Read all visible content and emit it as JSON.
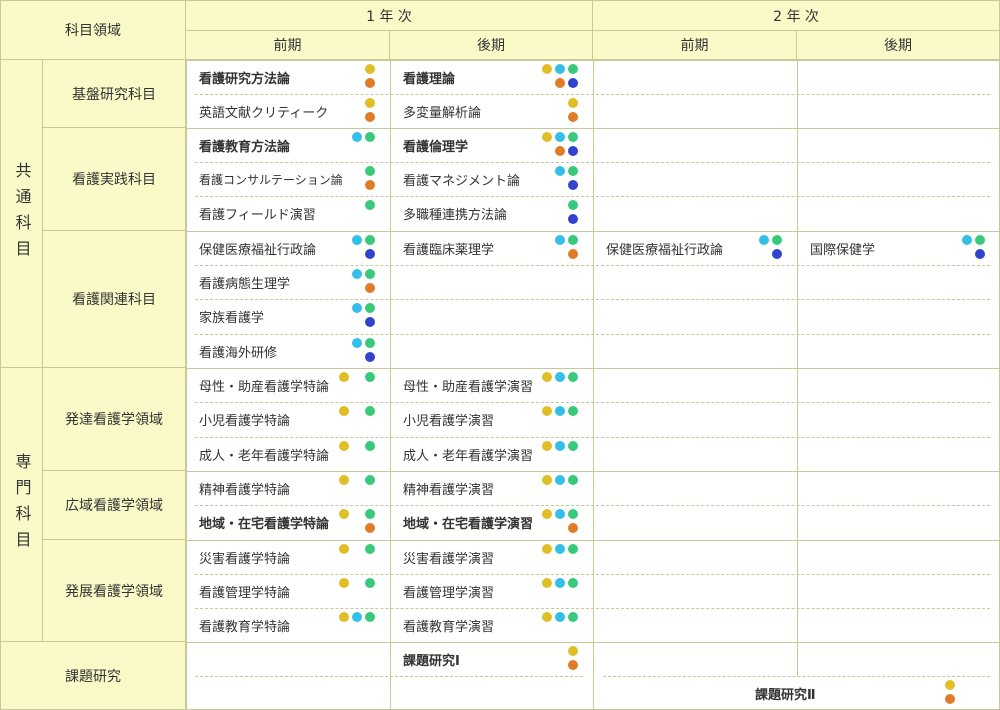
{
  "header": {
    "field_label": "科目領域",
    "year1": "1 年 次",
    "year2": "2 年 次",
    "t1_first": "前期",
    "t1_second": "後期",
    "t2_first": "前期",
    "t2_second": "後期"
  },
  "groups": {
    "common": "共通科目",
    "specialized": "専門科目"
  },
  "subgroups": {
    "kiban": "基盤研究科目",
    "jissen": "看護実践科目",
    "kanren": "看護関連科目",
    "hattatsu": "発達看護学領域",
    "kouiki": "広域看護学領域",
    "hatten": "発展看護学領域",
    "kadai": "課題研究"
  },
  "dot_colors": {
    "yellow": "#e0bf26",
    "orange": "#e07b28",
    "cyan": "#33bfe8",
    "green": "#38c97a",
    "blue": "#3344cc"
  },
  "courses": {
    "y1f": [
      {
        "label": "看護研究方法論",
        "bold": true,
        "dots": [
          [
            "yellow"
          ],
          [
            "orange"
          ]
        ]
      },
      {
        "label": "英語文献クリティーク",
        "dots": [
          [
            "yellow"
          ],
          [
            "orange"
          ]
        ]
      },
      {
        "label": "看護教育方法論",
        "bold": true,
        "dots": [
          [
            "cyan",
            "green"
          ]
        ]
      },
      {
        "label": "看護コンサルテーション論",
        "small": true,
        "dots": [
          [
            "green"
          ],
          [
            "orange"
          ]
        ]
      },
      {
        "label": "看護フィールド演習",
        "dots": [
          [
            "green"
          ]
        ]
      },
      {
        "label": "保健医療福祉行政論",
        "dots": [
          [
            "cyan",
            "green"
          ],
          [
            "blue"
          ]
        ]
      },
      {
        "label": "看護病態生理学",
        "dots": [
          [
            "cyan",
            "green"
          ],
          [
            "orange"
          ]
        ]
      },
      {
        "label": "家族看護学",
        "dots": [
          [
            "cyan",
            "green"
          ],
          [
            "blue"
          ]
        ]
      },
      {
        "label": "看護海外研修",
        "dots": [
          [
            "cyan",
            "green"
          ],
          [
            "blue"
          ]
        ]
      },
      {
        "label": "母性・助産看護学特論",
        "dots": [
          [
            "yellow",
            "",
            "green"
          ]
        ]
      },
      {
        "label": "小児看護学特論",
        "dots": [
          [
            "yellow",
            "",
            "green"
          ]
        ]
      },
      {
        "label": "成人・老年看護学特論",
        "dots": [
          [
            "yellow",
            "",
            "green"
          ]
        ]
      },
      {
        "label": "精神看護学特論",
        "dots": [
          [
            "yellow",
            "",
            "green"
          ]
        ]
      },
      {
        "label": "地域・在宅看護学特論",
        "bold": true,
        "dots": [
          [
            "yellow",
            "",
            "green"
          ],
          [
            "orange"
          ]
        ]
      },
      {
        "label": "災害看護学特論",
        "dots": [
          [
            "yellow",
            "",
            "green"
          ]
        ]
      },
      {
        "label": "看護管理学特論",
        "dots": [
          [
            "yellow",
            "",
            "green"
          ]
        ]
      },
      {
        "label": "看護教育学特論",
        "dots": [
          [
            "yellow",
            "cyan",
            "green"
          ]
        ]
      }
    ],
    "y1s": [
      {
        "label": "看護理論",
        "bold": true,
        "dots": [
          [
            "yellow",
            "cyan",
            "green"
          ],
          [
            "orange",
            "blue"
          ]
        ]
      },
      {
        "label": "多変量解析論",
        "dots": [
          [
            "yellow"
          ],
          [
            "orange"
          ]
        ]
      },
      {
        "label": "看護倫理学",
        "bold": true,
        "dots": [
          [
            "yellow",
            "cyan",
            "green"
          ],
          [
            "orange",
            "blue"
          ]
        ]
      },
      {
        "label": "看護マネジメント論",
        "dots": [
          [
            "cyan",
            "green"
          ],
          [
            "blue"
          ]
        ]
      },
      {
        "label": "多職種連携方法論",
        "dots": [
          [
            "green"
          ],
          [
            "blue"
          ]
        ]
      },
      {
        "label": "看護臨床薬理学",
        "dots": [
          [
            "cyan",
            "green"
          ],
          [
            "orange"
          ]
        ]
      },
      {
        "label": "母性・助産看護学演習",
        "dots": [
          [
            "yellow",
            "cyan",
            "green"
          ]
        ]
      },
      {
        "label": "小児看護学演習",
        "dots": [
          [
            "yellow",
            "cyan",
            "green"
          ]
        ]
      },
      {
        "label": "成人・老年看護学演習",
        "dots": [
          [
            "yellow",
            "cyan",
            "green"
          ]
        ]
      },
      {
        "label": "精神看護学演習",
        "dots": [
          [
            "yellow",
            "cyan",
            "green"
          ]
        ]
      },
      {
        "label": "地域・在宅看護学演習",
        "bold": true,
        "dots": [
          [
            "yellow",
            "cyan",
            "green"
          ],
          [
            "orange"
          ]
        ]
      },
      {
        "label": "災害看護学演習",
        "dots": [
          [
            "yellow",
            "cyan",
            "green"
          ]
        ]
      },
      {
        "label": "看護管理学演習",
        "dots": [
          [
            "yellow",
            "cyan",
            "green"
          ]
        ]
      },
      {
        "label": "看護教育学演習",
        "dots": [
          [
            "yellow",
            "cyan",
            "green"
          ]
        ]
      },
      {
        "label": "課題研究Ⅰ",
        "bold": true,
        "dots": [
          [
            "yellow"
          ],
          [
            "orange"
          ]
        ]
      }
    ],
    "y2f": [
      {
        "label": "保健医療福祉行政論",
        "dots": [
          [
            "cyan",
            "green"
          ],
          [
            "blue"
          ]
        ]
      }
    ],
    "y2s": [
      {
        "label": "国際保健学",
        "dots": [
          [
            "cyan",
            "green"
          ],
          [
            "blue"
          ]
        ]
      }
    ],
    "y2": [
      {
        "label": "課題研究Ⅱ",
        "bold": true,
        "dots": [
          [
            "yellow"
          ],
          [
            "orange"
          ]
        ]
      }
    ]
  }
}
